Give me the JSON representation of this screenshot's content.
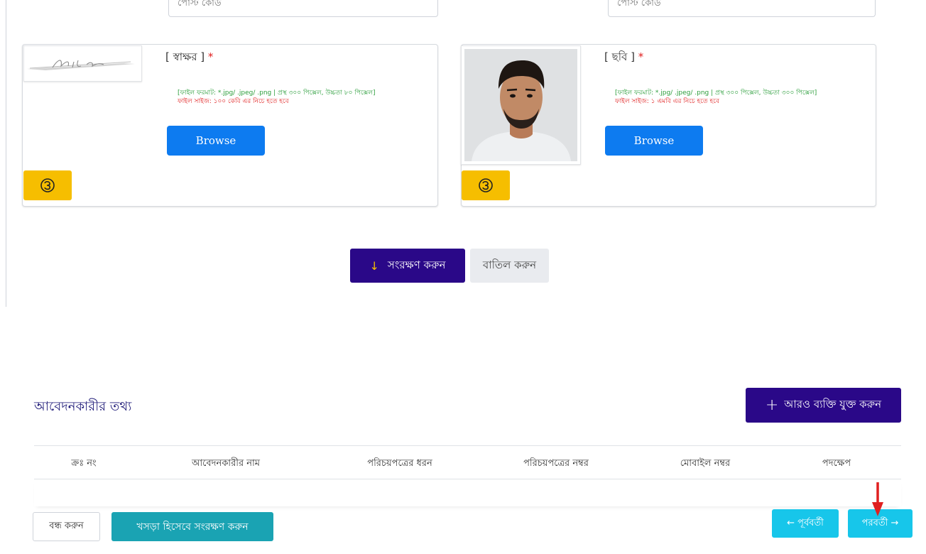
{
  "top_form": {
    "left_field_text": "পোস্ট কোড",
    "right_field_text": "পোস্ট কোড"
  },
  "signature_card": {
    "title": "[ স্বাক্ষর ]",
    "required_mark": "*",
    "format_hint": "[ফাইল ফরমাট: *.jpg/ .jpeg/ .png | প্রস্থ ৩০০ পিক্সেল, উচ্চতা ৮০ পিক্সেল]",
    "size_hint": "ফাইল সাইজ: ১০০ কেবি এর নিচে হতে হবে",
    "browse_label": "Browse",
    "rotate_icon": "rotate-icon"
  },
  "photo_card": {
    "title": "[ ছবি ]",
    "required_mark": "*",
    "format_hint": "[ফাইল ফরমাট: *.jpg/ .jpeg/ .png | প্রস্থ ৩০০ পিক্সেল, উচ্চতা ৩০০ পিক্সেল]",
    "size_hint": "ফাইল সাইজ: ১ এমবি এর নিচে হতে হবে",
    "browse_label": "Browse",
    "rotate_icon": "rotate-icon"
  },
  "form_actions": {
    "save_icon": "↓",
    "save_label": "সংরক্ষণ করুন",
    "cancel_label": "বাতিল করুন"
  },
  "applicant_section": {
    "title": "আবেদনকারীর তথ্য",
    "add_icon": "+",
    "add_label": "আরও ব্যক্তি যুক্ত করুন",
    "columns": [
      "ক্রঃ নং",
      "আবেদনকারীর নাম",
      "পরিচয়পত্রের ধরন",
      "পরিচয়পত্রের নম্বর",
      "মোবাইল নম্বর",
      "পদক্ষেপ"
    ]
  },
  "footer": {
    "close_label": "বন্ধ করুন",
    "draft_label": "খসড়া হিসেবে সংরক্ষণ করুন",
    "prev_label": "← পূর্ববর্তী",
    "next_label": "পরবর্তী →"
  },
  "colors": {
    "primary": "#2a0888",
    "browse": "#0d7bf0",
    "rotate": "#f6be00",
    "draft": "#1aa3b3",
    "nav": "#17c6ea",
    "required": "#e02020",
    "hint_green": "#2a9d3a",
    "annotation_arrow": "#e02020"
  }
}
